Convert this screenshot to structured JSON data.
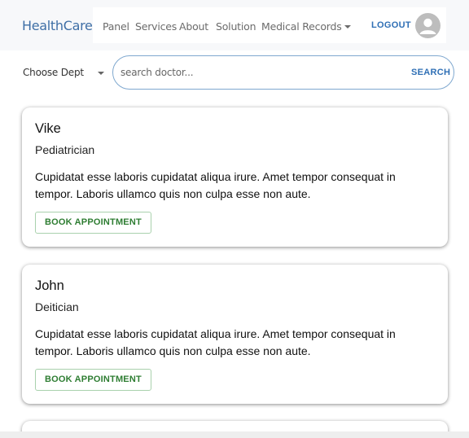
{
  "navbar": {
    "brand": "HealthCare",
    "links": [
      "Panel",
      "Services",
      "About",
      "Solution",
      "Medical Records"
    ],
    "logout_label": "LOGOUT"
  },
  "filter": {
    "dept_label": "Choose Dept",
    "search_placeholder": "search doctor...",
    "search_label": "SEARCH"
  },
  "doctors": [
    {
      "name": "Vike",
      "specialty": "Pediatrician",
      "description": "Cupidatat esse laboris cupidatat aliqua irure. Amet tempor consequat in tempor. Laboris ullamco quis non culpa esse non aute.",
      "button": "BOOK APPOINTMENT"
    },
    {
      "name": "John",
      "specialty": "Deitician",
      "description": "Cupidatat esse laboris cupidatat aliqua irure. Amet tempor consequat in tempor. Laboris ullamco quis non culpa esse non aute.",
      "button": "BOOK APPOINTMENT"
    }
  ],
  "icons": {
    "avatar": "account-circle-icon",
    "dropdown": "chevron-down-icon"
  },
  "colors": {
    "brand": "#3f6fa6",
    "accent": "#2f6fb5",
    "book_button": "#2e7d32"
  }
}
